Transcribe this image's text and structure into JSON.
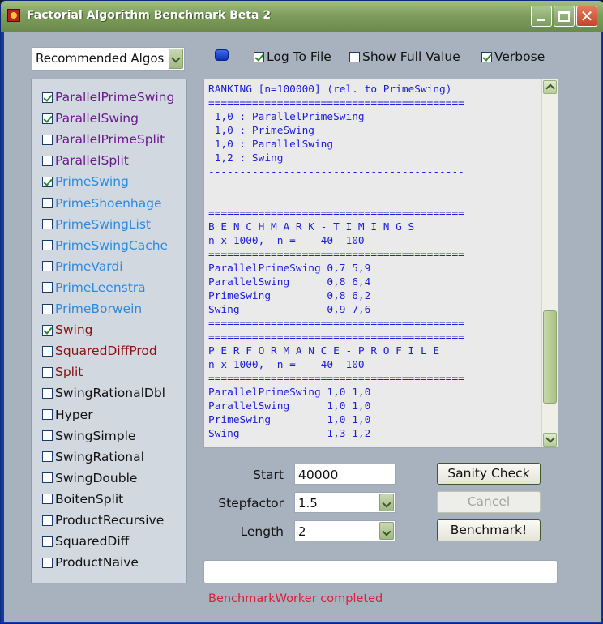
{
  "window": {
    "title": "Factorial Algorithm Benchmark Beta 2"
  },
  "toolbar": {
    "algo_filter": "Recommended Algos",
    "log_to_file": {
      "label": "Log To File",
      "checked": true
    },
    "show_full_value": {
      "label": "Show Full Value",
      "checked": false
    },
    "verbose": {
      "label": "Verbose",
      "checked": true
    }
  },
  "algorithms": [
    {
      "label": "ParallelPrimeSwing",
      "checked": true,
      "color": "#6a1a8a"
    },
    {
      "label": "ParallelSwing",
      "checked": true,
      "color": "#6a1a8a"
    },
    {
      "label": "ParallelPrimeSplit",
      "checked": false,
      "color": "#6a1a8a"
    },
    {
      "label": "ParallelSplit",
      "checked": false,
      "color": "#6a1a8a"
    },
    {
      "label": "PrimeSwing",
      "checked": true,
      "color": "#2e8ae0"
    },
    {
      "label": "PrimeShoenhage",
      "checked": false,
      "color": "#2e8ae0"
    },
    {
      "label": "PrimeSwingList",
      "checked": false,
      "color": "#2e8ae0"
    },
    {
      "label": "PrimeSwingCache",
      "checked": false,
      "color": "#2e8ae0"
    },
    {
      "label": "PrimeVardi",
      "checked": false,
      "color": "#2e8ae0"
    },
    {
      "label": "PrimeLeenstra",
      "checked": false,
      "color": "#2e8ae0"
    },
    {
      "label": "PrimeBorwein",
      "checked": false,
      "color": "#2e8ae0"
    },
    {
      "label": "Swing",
      "checked": true,
      "color": "#8a1010"
    },
    {
      "label": "SquaredDiffProd",
      "checked": false,
      "color": "#8a1010"
    },
    {
      "label": "Split",
      "checked": false,
      "color": "#8a1010"
    },
    {
      "label": "SwingRationalDbl",
      "checked": false,
      "color": "#111111"
    },
    {
      "label": "Hyper",
      "checked": false,
      "color": "#111111"
    },
    {
      "label": "SwingSimple",
      "checked": false,
      "color": "#111111"
    },
    {
      "label": "SwingRational",
      "checked": false,
      "color": "#111111"
    },
    {
      "label": "SwingDouble",
      "checked": false,
      "color": "#111111"
    },
    {
      "label": "BoitenSplit",
      "checked": false,
      "color": "#111111"
    },
    {
      "label": "ProductRecursive",
      "checked": false,
      "color": "#111111"
    },
    {
      "label": "SquaredDiff",
      "checked": false,
      "color": "#111111"
    },
    {
      "label": "ProductNaive",
      "checked": false,
      "color": "#111111"
    }
  ],
  "output_lines": [
    "RANKING [n=100000] (rel. to PrimeSwing)",
    "=========================================",
    " 1,0 : ParallelPrimeSwing",
    " 1,0 : PrimeSwing",
    " 1,0 : ParallelSwing",
    " 1,2 : Swing",
    "-----------------------------------------",
    "",
    "",
    "=========================================",
    "B E N C H M A R K - T I M I N G S",
    "n x 1000,  n =    40  100",
    "=========================================",
    "ParallelPrimeSwing 0,7 5,9",
    "ParallelSwing      0,8 6,4",
    "PrimeSwing         0,8 6,2",
    "Swing              0,9 7,6",
    "=========================================",
    "=========================================",
    "P E R F O R M A N C E - P R O F I L E",
    "n x 1000,  n =    40  100",
    "=========================================",
    "ParallelPrimeSwing 1,0 1,0",
    "ParallelSwing      1,0 1,0",
    "PrimeSwing         1,0 1,0",
    "Swing              1,3 1,2"
  ],
  "form": {
    "start_label": "Start",
    "start_value": "40000",
    "stepfactor_label": "Stepfactor",
    "stepfactor_value": "1.5",
    "length_label": "Length",
    "length_value": "2"
  },
  "buttons": {
    "sanity_check": "Sanity Check",
    "cancel": "Cancel",
    "benchmark": "Benchmark!"
  },
  "progress_text": "",
  "status": "BenchmarkWorker completed"
}
